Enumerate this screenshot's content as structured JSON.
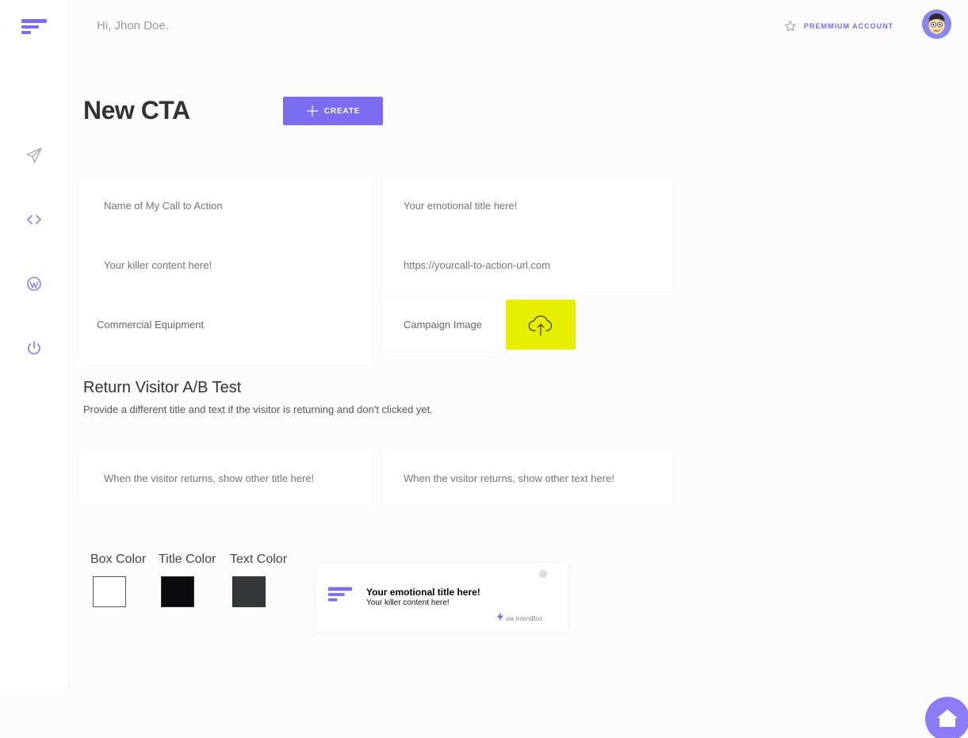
{
  "header": {
    "greeting": "Hi, Jhon Doe.",
    "account_label": "PREMMIUM ACCOUNT"
  },
  "sidebar": {
    "items": [
      {
        "icon": "send-icon"
      },
      {
        "icon": "code-icon"
      },
      {
        "icon": "wordpress-icon"
      },
      {
        "icon": "power-icon"
      }
    ]
  },
  "page": {
    "title": "New CTA",
    "create_label": "CREATE"
  },
  "form": {
    "name_placeholder": "Name of My Call to Action",
    "title_placeholder": "Your emotional title here!",
    "content_placeholder": "Your killer content here!",
    "url_placeholder": "https://yourcall-to-action-url.com",
    "category_value": "Commercial Equipment",
    "image_label": "Campaign Image"
  },
  "ab_test": {
    "title": "Return Visitor A/B Test",
    "description": "Provide a different title and text if the visitor is returning and don't clicked yet.",
    "title_placeholder": "When the visitor returns, show other title here!",
    "text_placeholder": "When the visitor returns, show other text here!"
  },
  "colors": {
    "box_label": "Box Color",
    "title_label": "Title Color",
    "text_label": "Text Color",
    "box_value": "#ffffff",
    "title_value": "#0b0b0d",
    "text_value": "#35373a"
  },
  "preview": {
    "title": "Your emotional title here!",
    "text": "Your killer content here!",
    "via": "via IntentBox"
  },
  "theme": {
    "accent": "#7b6cf0",
    "upload_bg": "#e8ee00"
  }
}
